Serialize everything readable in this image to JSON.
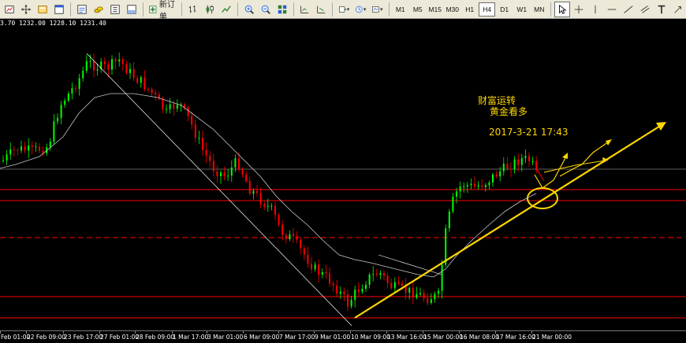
{
  "toolbar": {
    "new_order_label": "新订单",
    "timeframes": [
      "M1",
      "M5",
      "M15",
      "M30",
      "H1",
      "H4",
      "D1",
      "W1",
      "MN"
    ],
    "active_timeframe": "H4",
    "icons": [
      "new-chart-icon",
      "crosshair-move-icon",
      "profiles-icon",
      "window-icon",
      "market-watch-icon",
      "gold-coins-icon",
      "navigator-icon",
      "terminal-icon",
      "new-order-icon",
      "bar-chart-icon",
      "candle-chart-icon",
      "line-chart-icon",
      "zoom-in-icon",
      "zoom-out-icon",
      "tile-windows-icon",
      "scroll-end-icon",
      "shift-end-icon",
      "indicators-icon",
      "periods-icon",
      "templates-icon",
      "cursor-icon",
      "crosshair-icon",
      "vertical-line-icon",
      "horizontal-line-icon",
      "trendline-icon",
      "channel-icon",
      "text-icon",
      "arrow-icon"
    ]
  },
  "chart": {
    "ohlc_text": "3.70 1232.00 1228.10 1231.40",
    "annotations": {
      "line1": "财富运转",
      "line2": "黄金看多",
      "line3": "2017-3-21    17:43"
    },
    "colors": {
      "background": "#000000",
      "bull_candle": "#00ff00",
      "bear_candle": "#ff0000",
      "moving_average": "#c8c8c8",
      "annotation": "#ffd700",
      "level_lines": "#ff0000",
      "current_price_line": "#c0c0c0"
    },
    "time_labels": [
      "Feb 01:00",
      "22 Feb 09:00",
      "23 Feb 17:00",
      "27 Feb 01:00",
      "28 Feb 09:00",
      "1 Mar 17:00",
      "3 Mar 01:00",
      "6 Mar 09:00",
      "7 Mar 17:00",
      "9 Mar 01:00",
      "10 Mar 09:00",
      "13 Mar 16:00",
      "15 Mar 00:00",
      "16 Mar 08:00",
      "17 Mar 16:00",
      "21 Mar 00:00"
    ]
  }
}
